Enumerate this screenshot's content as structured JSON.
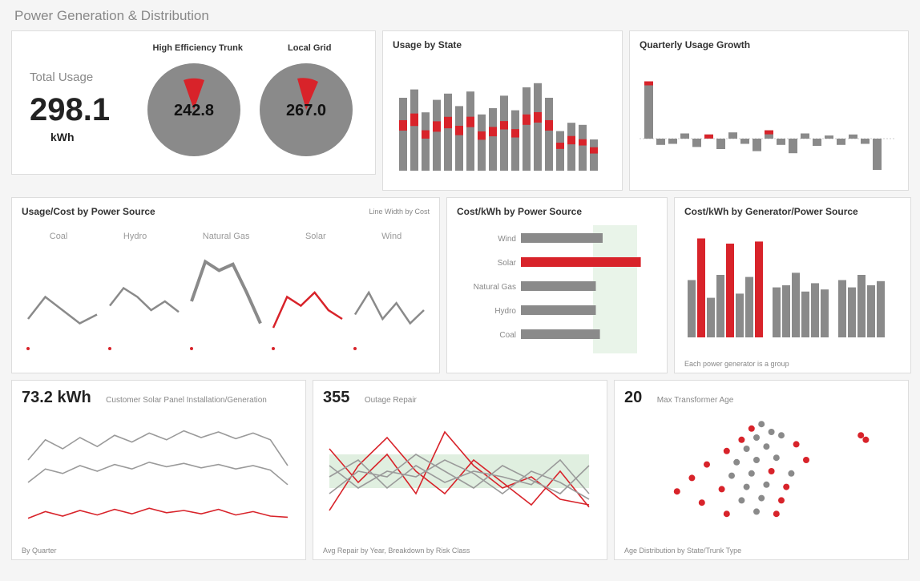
{
  "page_title": "Power Generation & Distribution",
  "totals": {
    "label": "Total Usage",
    "value": "298.1",
    "unit": "kWh",
    "gauges": [
      {
        "title": "High Efficiency Trunk",
        "value": "242.8"
      },
      {
        "title": "Local Grid",
        "value": "267.0"
      }
    ]
  },
  "usage_by_state": {
    "title": "Usage by State"
  },
  "quarterly_growth": {
    "title": "Quarterly Usage Growth"
  },
  "usage_cost_by_source": {
    "title": "Usage/Cost by Power Source",
    "note": "Line Width by Cost",
    "sources": [
      "Coal",
      "Hydro",
      "Natural Gas",
      "Solar",
      "Wind"
    ]
  },
  "cost_kwh_by_source": {
    "title": "Cost/kWh by Power Source",
    "labels": [
      "Wind",
      "Solar",
      "Natural Gas",
      "Hydro",
      "Coal"
    ]
  },
  "cost_kwh_by_gen": {
    "title": "Cost/kWh by Generator/Power Source",
    "footnote": "Each power generator is a group"
  },
  "solar_install": {
    "value": "73.2 kWh",
    "title": "Customer Solar Panel Installation/Generation",
    "footnote": "By Quarter"
  },
  "outage_repair": {
    "value": "355",
    "title": "Outage Repair",
    "footnote": "Avg Repair by Year, Breakdown by Risk Class"
  },
  "transformer_age": {
    "value": "20",
    "title": "Max Transformer Age",
    "footnote": "Age Distribution by State/Trunk Type"
  },
  "chart_data": {
    "usage_by_state": {
      "type": "bar",
      "note": "stacked bars with red segment mid-stack; values estimated relative 0-100",
      "series": [
        {
          "name": "gray",
          "values": [
            70,
            78,
            56,
            68,
            74,
            62,
            76,
            54,
            60,
            72,
            58,
            80,
            84,
            70,
            38,
            46,
            44,
            30
          ]
        },
        {
          "name": "red_overlay",
          "values": [
            10,
            12,
            8,
            10,
            11,
            9,
            10,
            8,
            9,
            8,
            8,
            10,
            10,
            10,
            6,
            8,
            6,
            6
          ]
        }
      ]
    },
    "quarterly_growth": {
      "type": "bar",
      "note": "positive/negative bars around baseline; values estimated -40..60",
      "values": [
        55,
        -6,
        -5,
        5,
        -8,
        4,
        -10,
        6,
        -5,
        -12,
        8,
        -6,
        -14,
        5,
        -7,
        3,
        -6,
        4,
        -5,
        -30
      ],
      "red_caps": [
        true,
        false,
        false,
        false,
        false,
        true,
        false,
        false,
        false,
        false,
        true,
        false,
        false,
        false,
        false,
        false,
        false,
        false,
        false,
        false
      ]
    },
    "usage_cost_by_source": {
      "type": "line",
      "categories": [
        "Coal",
        "Hydro",
        "Natural Gas",
        "Solar",
        "Wind"
      ],
      "note": "small sparkline per category, Solar in red, others gray; y 0-100 est.",
      "series": {
        "Coal": [
          30,
          55,
          40,
          25,
          35
        ],
        "Hydro": [
          45,
          65,
          55,
          40,
          50,
          38
        ],
        "Natural Gas": [
          50,
          95,
          85,
          92,
          60,
          25
        ],
        "Solar": [
          20,
          55,
          45,
          60,
          40,
          30
        ],
        "Wind": [
          35,
          60,
          30,
          48,
          25,
          40
        ]
      }
    },
    "cost_kwh_by_source": {
      "type": "bar",
      "orientation": "horizontal",
      "categories": [
        "Wind",
        "Solar",
        "Natural Gas",
        "Hydro",
        "Coal"
      ],
      "values": [
        60,
        88,
        55,
        55,
        58
      ],
      "highlight": "Solar"
    },
    "cost_kwh_by_gen": {
      "type": "bar",
      "note": "grouped bars, some red; heights 0-100 est.",
      "groups": [
        [
          55,
          95,
          38,
          60,
          90,
          42,
          58,
          92
        ],
        [
          48,
          50,
          62,
          44,
          52,
          46
        ],
        [
          55,
          48,
          60,
          50,
          54
        ]
      ],
      "red_indices_flat": [
        1,
        4,
        7
      ]
    },
    "solar_install": {
      "type": "line",
      "note": "three series over ~16 quarters, y 0-100 est.",
      "x_count": 16,
      "series": [
        {
          "name": "top-gray",
          "values": [
            60,
            78,
            70,
            80,
            72,
            82,
            76,
            84,
            78,
            86,
            80,
            85,
            79,
            84,
            78,
            55
          ]
        },
        {
          "name": "mid-gray",
          "values": [
            40,
            52,
            48,
            55,
            50,
            56,
            52,
            58,
            54,
            57,
            53,
            56,
            52,
            55,
            51,
            38
          ]
        },
        {
          "name": "red",
          "values": [
            8,
            14,
            10,
            15,
            11,
            16,
            12,
            17,
            13,
            15,
            12,
            16,
            11,
            14,
            10,
            9
          ]
        }
      ]
    },
    "outage_repair": {
      "type": "line",
      "note": "multiple crossing lines, 2 red 3 gray over ~10 years; y 0-100 est.",
      "x_count": 10,
      "band": [
        35,
        65
      ],
      "series": [
        {
          "name": "r1",
          "color": "red",
          "values": [
            70,
            40,
            65,
            30,
            85,
            55,
            35,
            45,
            25,
            20
          ]
        },
        {
          "name": "r2",
          "color": "red",
          "values": [
            15,
            55,
            80,
            50,
            30,
            60,
            40,
            20,
            50,
            18
          ]
        },
        {
          "name": "g1",
          "color": "gray",
          "values": [
            45,
            60,
            35,
            55,
            40,
            50,
            45,
            38,
            60,
            30
          ]
        },
        {
          "name": "g2",
          "color": "gray",
          "values": [
            30,
            50,
            45,
            65,
            50,
            35,
            55,
            42,
            30,
            55
          ]
        },
        {
          "name": "g3",
          "color": "gray",
          "values": [
            55,
            35,
            50,
            45,
            60,
            48,
            30,
            50,
            40,
            25
          ]
        }
      ]
    },
    "transformer_age": {
      "type": "scatter",
      "note": "points colored red/gray; axes not labeled, positions 0-100 est.",
      "points": [
        {
          "x": 48,
          "y": 12,
          "c": "red"
        },
        {
          "x": 52,
          "y": 8,
          "c": "gray"
        },
        {
          "x": 56,
          "y": 15,
          "c": "gray"
        },
        {
          "x": 44,
          "y": 22,
          "c": "red"
        },
        {
          "x": 50,
          "y": 20,
          "c": "gray"
        },
        {
          "x": 60,
          "y": 18,
          "c": "gray"
        },
        {
          "x": 38,
          "y": 32,
          "c": "red"
        },
        {
          "x": 46,
          "y": 30,
          "c": "gray"
        },
        {
          "x": 54,
          "y": 28,
          "c": "gray"
        },
        {
          "x": 66,
          "y": 26,
          "c": "red"
        },
        {
          "x": 30,
          "y": 44,
          "c": "red"
        },
        {
          "x": 42,
          "y": 42,
          "c": "gray"
        },
        {
          "x": 50,
          "y": 40,
          "c": "gray"
        },
        {
          "x": 58,
          "y": 38,
          "c": "gray"
        },
        {
          "x": 70,
          "y": 40,
          "c": "red"
        },
        {
          "x": 92,
          "y": 18,
          "c": "red"
        },
        {
          "x": 24,
          "y": 56,
          "c": "red"
        },
        {
          "x": 40,
          "y": 54,
          "c": "gray"
        },
        {
          "x": 48,
          "y": 52,
          "c": "gray"
        },
        {
          "x": 56,
          "y": 50,
          "c": "red"
        },
        {
          "x": 64,
          "y": 52,
          "c": "gray"
        },
        {
          "x": 94,
          "y": 22,
          "c": "red"
        },
        {
          "x": 18,
          "y": 68,
          "c": "red"
        },
        {
          "x": 36,
          "y": 66,
          "c": "red"
        },
        {
          "x": 46,
          "y": 64,
          "c": "gray"
        },
        {
          "x": 54,
          "y": 62,
          "c": "gray"
        },
        {
          "x": 62,
          "y": 64,
          "c": "red"
        },
        {
          "x": 28,
          "y": 78,
          "c": "red"
        },
        {
          "x": 44,
          "y": 76,
          "c": "gray"
        },
        {
          "x": 52,
          "y": 74,
          "c": "gray"
        },
        {
          "x": 60,
          "y": 76,
          "c": "red"
        },
        {
          "x": 38,
          "y": 88,
          "c": "red"
        },
        {
          "x": 50,
          "y": 86,
          "c": "gray"
        },
        {
          "x": 58,
          "y": 88,
          "c": "red"
        }
      ]
    }
  }
}
